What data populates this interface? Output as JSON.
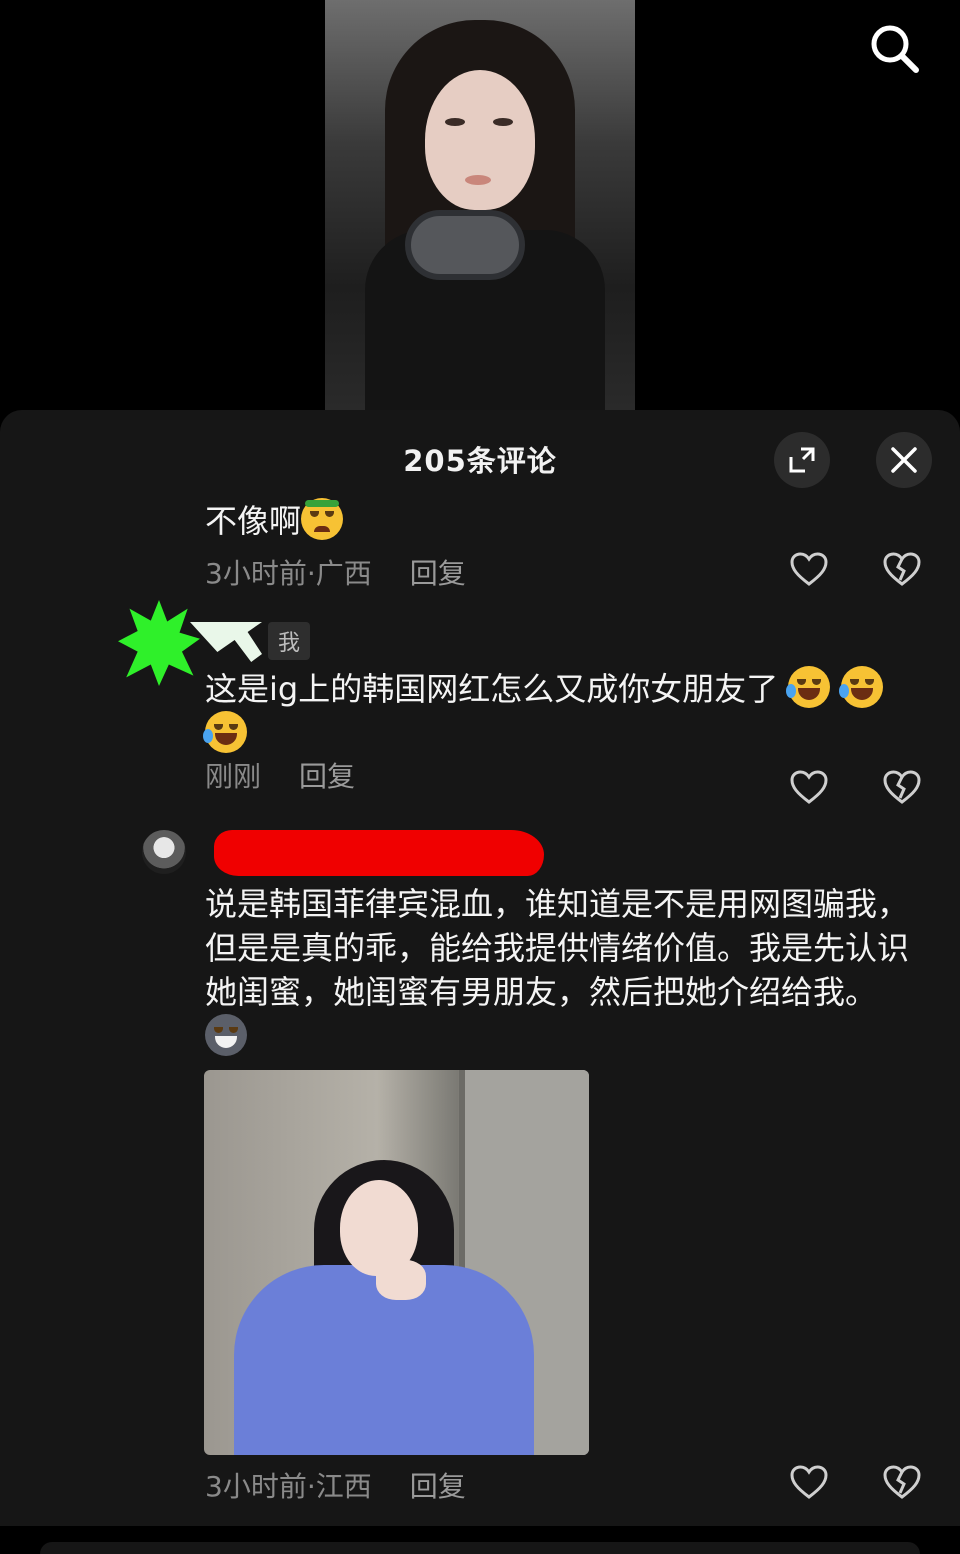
{
  "sheet": {
    "title": "205条评论"
  },
  "comments": [
    {
      "text": "不像啊",
      "time_location": "3小时前·广西",
      "reply_label": "回复"
    },
    {
      "me_tag": "我",
      "text": "这是ig上的韩国网红怎么又成你女朋友了",
      "time_location": "刚刚",
      "reply_label": "回复"
    },
    {
      "text": "说是韩国菲律宾混血，谁知道是不是用网图骗我，但是是真的乖，能给我提供情绪价值。我是先认识她闺蜜，她闺蜜有男朋友，然后把她介绍给我。",
      "time_location": "3小时前·江西",
      "reply_label": "回复"
    }
  ],
  "colors": {
    "sheet_bg": "#161616",
    "meta_text": "#8a8a8a",
    "redaction_red": "#f00000",
    "redaction_green": "#2ff02a"
  },
  "icons": [
    "search-icon",
    "expand-icon",
    "close-icon",
    "heart-icon",
    "broken-heart-icon",
    "angry-emoji",
    "laughing-tears-emoji",
    "husky-emoji"
  ]
}
